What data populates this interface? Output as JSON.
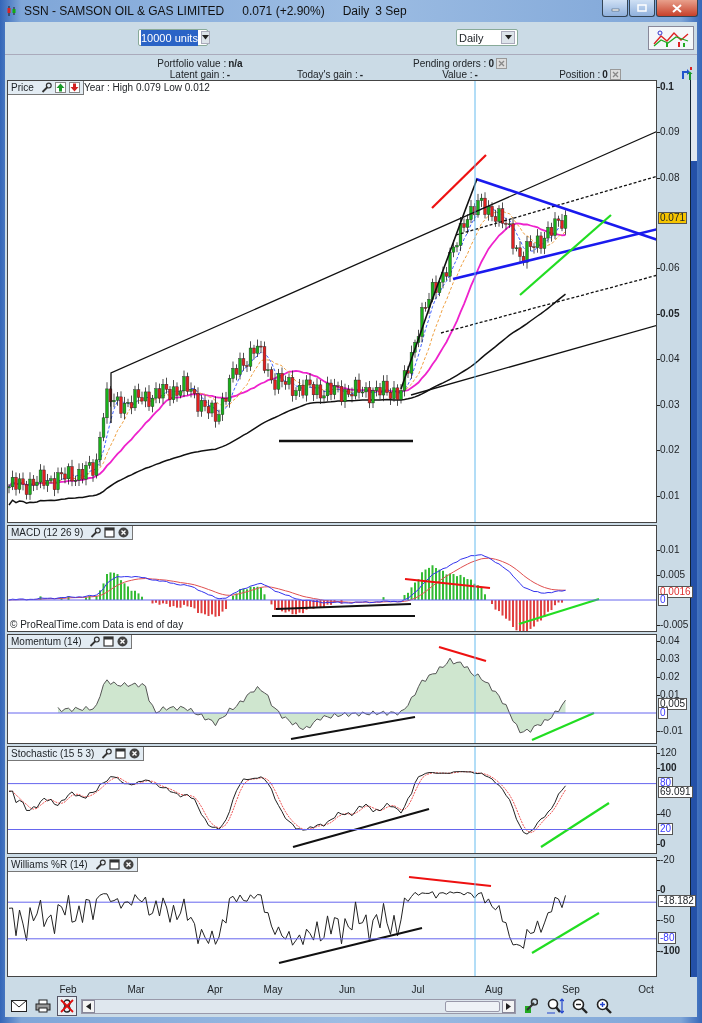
{
  "window": {
    "title": "SSN - SAMSON OIL & GAS LIMITED",
    "quote": "0.071 (+2.90%)",
    "period": "Daily",
    "date": "3 Sep"
  },
  "toolbar": {
    "quantity": {
      "value": "10000 units",
      "focused": true
    },
    "timeframe": {
      "value": "Daily"
    }
  },
  "account_rows": [
    [
      {
        "label": "Portfolio value :",
        "value": "n/a",
        "clear_button": false
      },
      {
        "label": "Pending orders :",
        "value": "0",
        "clear_button": true
      }
    ],
    [
      {
        "label": "Latent gain :",
        "value": "-",
        "clear_button": false
      },
      {
        "label": "Today's gain :",
        "value": "-",
        "clear_button": false
      },
      {
        "label": "Value :",
        "value": "-",
        "clear_button": false
      },
      {
        "label": "Position :",
        "value": "0",
        "clear_button": true
      }
    ]
  ],
  "panels": [
    {
      "kind": "price",
      "title": "Price",
      "info": "Year : High 0.079 Low 0.012",
      "ticks": [
        {
          "label": "0.1",
          "bold": true
        },
        {
          "label": "0.09",
          "bold": false
        },
        {
          "label": "0.08",
          "bold": false
        },
        {
          "label": "0.06",
          "bold": false
        },
        {
          "label": "0.05",
          "bold": true
        },
        {
          "label": "0.04",
          "bold": false
        },
        {
          "label": "0.03",
          "bold": false
        },
        {
          "label": "0.02",
          "bold": false
        },
        {
          "label": "0.01",
          "bold": false
        }
      ],
      "badges": [
        {
          "text": "0.071",
          "kind": "last"
        }
      ]
    },
    {
      "kind": "macd",
      "title": "MACD (12 26 9)",
      "note": "© ProRealTime.com  Data is end of day",
      "ticks": [
        {
          "label": "0.01",
          "bold": false
        },
        {
          "label": "0.005",
          "bold": false
        },
        {
          "label": "-0.005",
          "bold": false
        }
      ],
      "badges": [
        {
          "text": "0.0016",
          "kind": "signal"
        },
        {
          "text": "0",
          "kind": "level"
        }
      ]
    },
    {
      "kind": "momentum",
      "title": "Momentum (14)",
      "ticks": [
        {
          "label": "0.04",
          "bold": false
        },
        {
          "label": "0.03",
          "bold": false
        },
        {
          "label": "0.02",
          "bold": false
        },
        {
          "label": "0.01",
          "bold": false
        },
        {
          "label": "-0.01",
          "bold": false
        }
      ],
      "badges": [
        {
          "text": "0.005",
          "kind": "reading"
        },
        {
          "text": "0",
          "kind": "level"
        }
      ]
    },
    {
      "kind": "stochastic",
      "title": "Stochastic (15 5 3)",
      "ticks": [
        {
          "label": "120",
          "bold": false
        },
        {
          "label": "100",
          "bold": true
        },
        {
          "label": "40",
          "bold": false
        },
        {
          "label": "0",
          "bold": true
        },
        {
          "label": "-20",
          "bold": false
        }
      ],
      "badges": [
        {
          "text": "80",
          "kind": "level"
        },
        {
          "text": "69.091",
          "kind": "reading"
        },
        {
          "text": "20",
          "kind": "level"
        }
      ]
    },
    {
      "kind": "williams",
      "title": "Williams %R (14)",
      "ticks": [
        {
          "label": "0",
          "bold": true
        },
        {
          "label": "-50",
          "bold": false
        },
        {
          "label": "-100",
          "bold": true
        }
      ],
      "badges": [
        {
          "text": "-18.182",
          "kind": "reading"
        },
        {
          "text": "-80",
          "kind": "level"
        }
      ]
    }
  ],
  "x_axis": {
    "labels": [
      "Feb",
      "Mar",
      "Apr",
      "May",
      "Jun",
      "Jul",
      "Aug",
      "Sep",
      "Oct"
    ]
  },
  "bottom_toolbar": {
    "crossed_tool_pressed": true
  }
}
